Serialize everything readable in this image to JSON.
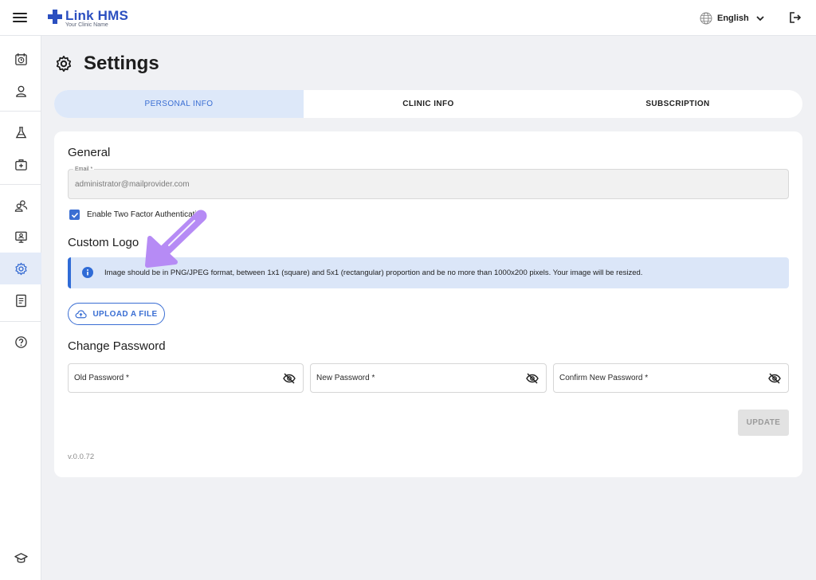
{
  "app": {
    "brand": "Link HMS",
    "subtitle": "Your Clinic Name",
    "brand_color": "#2b4fc0",
    "accent_color": "#3a6ed3"
  },
  "header": {
    "language": "English",
    "icons": [
      "menu-icon",
      "globe-icon",
      "chevron-down-icon",
      "logout-icon"
    ]
  },
  "sidebar": {
    "items": [
      {
        "icon": "calendar-clock-icon",
        "active": false
      },
      {
        "icon": "user-icon",
        "active": false
      },
      {
        "icon": "lab-flask-icon",
        "active": false
      },
      {
        "icon": "medical-kit-icon",
        "active": false
      },
      {
        "icon": "patients-group-icon",
        "active": false
      },
      {
        "icon": "monitor-user-icon",
        "active": false
      },
      {
        "icon": "gear-icon",
        "active": true
      },
      {
        "icon": "report-document-icon",
        "active": false
      },
      {
        "icon": "help-circle-icon",
        "active": false
      },
      {
        "icon": "graduation-cap-icon",
        "active": false
      }
    ]
  },
  "page": {
    "title": "Settings",
    "tabs": [
      {
        "label": "PERSONAL INFO",
        "active": true
      },
      {
        "label": "CLINIC INFO",
        "active": false
      },
      {
        "label": "SUBSCRIPTION",
        "active": false
      }
    ]
  },
  "general": {
    "title": "General",
    "email_label": "Email *",
    "email_value": "administrator@mailprovider.com",
    "two_factor_label": "Enable Two Factor Authentication",
    "two_factor_checked": true
  },
  "custom_logo": {
    "title": "Custom Logo",
    "info": "Image should be in PNG/JPEG format, between 1x1 (square) and 5x1 (rectangular) proportion and be no more than 1000x200 pixels. Your image will be resized.",
    "upload_label": "UPLOAD A FILE"
  },
  "change_password": {
    "title": "Change Password",
    "old_label": "Old Password *",
    "new_label": "New Password *",
    "confirm_label": "Confirm New Password *",
    "update_label": "UPDATE"
  },
  "footer": {
    "version": "v.0.0.72"
  },
  "annotation": {
    "arrow_color": "#b68bf5"
  }
}
